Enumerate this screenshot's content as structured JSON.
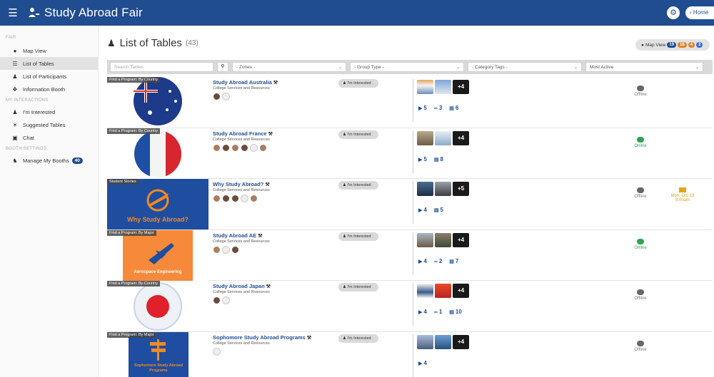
{
  "header": {
    "title": "Study Abroad Fair",
    "home_label": "Home"
  },
  "sidebar": {
    "section_fair": "FAIR",
    "map_view": "Map View",
    "list_of_tables": "List of Tables",
    "list_of_participants": "List of Participants",
    "information_booth": "Information Booth",
    "section_interactions": "MY INTERACTIONS",
    "im_interested": "I'm Interested",
    "suggested_tables": "Suggested Tables",
    "chat": "Chat",
    "section_booth": "BOOTH SETTINGS",
    "manage_booths": "Manage My Booths",
    "manage_booths_count": "40"
  },
  "main": {
    "title": "List of Tables",
    "count": "(43)",
    "mapview_label": "Map View",
    "mapview_badges": [
      {
        "value": "19",
        "color": "#1f4d8f"
      },
      {
        "value": "18",
        "color": "#e0822a"
      },
      {
        "value": "4",
        "color": "#e0822a"
      },
      {
        "value": "2",
        "color": "#3a6fd1"
      }
    ]
  },
  "filters": {
    "search_placeholder": "Search Tables",
    "zones": "- Zones -",
    "group_type": "- Group Type -",
    "category_tags": "- Category Tags -",
    "sort": "Most Active"
  },
  "interested_label": "I'm Interested",
  "tables": [
    {
      "name": "Study Abroad Australia",
      "tag": "Find a Program: By Country",
      "subtitle": "College Services and Resources",
      "stats": [
        {
          "icon": "play",
          "value": "5"
        },
        {
          "icon": "link",
          "value": "3"
        },
        {
          "icon": "doc",
          "value": "6"
        }
      ],
      "more_photos": "+4",
      "status": "Offline"
    },
    {
      "name": "Study Abroad France",
      "tag": "Find a Program: By Country",
      "subtitle": "College Services and Resources",
      "stats": [
        {
          "icon": "play",
          "value": "5"
        },
        {
          "icon": "doc",
          "value": "8"
        }
      ],
      "more_photos": "+4",
      "status": "Online"
    },
    {
      "name": "Why Study Abroad?",
      "tag": "Student Stories",
      "subtitle": "College Services and Resources",
      "image_text": "Why Study Abroad?",
      "stats": [
        {
          "icon": "play",
          "value": "4"
        },
        {
          "icon": "doc",
          "value": "5"
        }
      ],
      "more_photos": "+5",
      "status": "Offline",
      "event": {
        "date": "Mon, Oct 19",
        "time": "9:00am"
      }
    },
    {
      "name": "Study Abroad AE",
      "tag": "Find a Program: By Major",
      "subtitle": "College Services and Resources",
      "image_text": "Aerospace Engineering",
      "stats": [
        {
          "icon": "play",
          "value": "4"
        },
        {
          "icon": "link",
          "value": "2"
        },
        {
          "icon": "doc",
          "value": "7"
        }
      ],
      "more_photos": "+4",
      "status": "Online"
    },
    {
      "name": "Study Abroad Japan",
      "tag": "Find a Program: By Country",
      "subtitle": "College Services and Resources",
      "stats": [
        {
          "icon": "play",
          "value": "4"
        },
        {
          "icon": "link",
          "value": "1"
        },
        {
          "icon": "doc",
          "value": "10"
        }
      ],
      "more_photos": "+4",
      "status": "Offline"
    },
    {
      "name": "Sophomore Study Abroad Programs",
      "tag": "Find a Program: By Major",
      "subtitle": "College Services and Resources",
      "image_text": "Sophomore Study Abroad Programs",
      "stats": [
        {
          "icon": "play",
          "value": "4"
        }
      ],
      "more_photos": "+4",
      "status": "Offline"
    }
  ],
  "colors": {
    "brand": "#1f4d8f",
    "online": "#2ea44f",
    "offline": "#666666",
    "event": "#e6a317"
  }
}
